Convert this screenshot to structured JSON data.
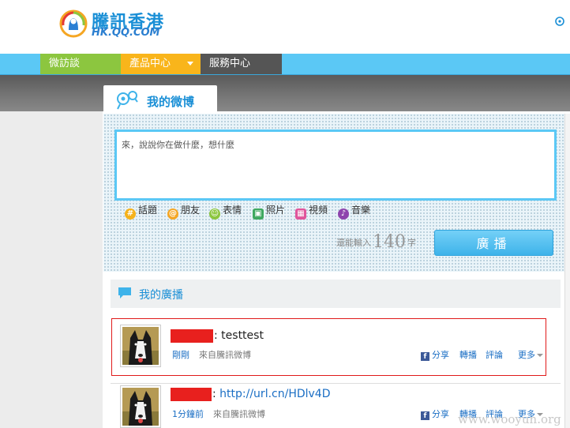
{
  "header": {
    "logo_text": "騰訊香港",
    "logo_sub": "HK.QQ.COM",
    "icon": "weibo-icon"
  },
  "nav": {
    "items": [
      {
        "label": "微訪談",
        "color": "#8cc63f"
      },
      {
        "label": "產品中心",
        "color": "#f9b51b"
      },
      {
        "label": "服務中心",
        "color": "#555555"
      }
    ]
  },
  "tab": {
    "label": "我的微博",
    "icon": "weibo-icon"
  },
  "compose": {
    "placeholder": "來，說說你在做什麼，想什麼",
    "tools": [
      {
        "label": "話題",
        "icon": "hashtag-icon",
        "color": "#f5b21b"
      },
      {
        "label": "朋友",
        "icon": "at-icon",
        "color": "#f5a623"
      },
      {
        "label": "表情",
        "icon": "smiley-icon",
        "color": "#8cc63f"
      },
      {
        "label": "照片",
        "icon": "photo-icon",
        "color": "#3fa860"
      },
      {
        "label": "視頻",
        "icon": "video-icon",
        "color": "#e0559b"
      },
      {
        "label": "音樂",
        "icon": "music-icon",
        "color": "#8e44ad"
      }
    ],
    "counter_prefix": "還能輸入",
    "counter_num": "140",
    "counter_suffix": "字",
    "button": "廣播"
  },
  "feed": {
    "title": "我的廣播",
    "posts": [
      {
        "text": ": testtest",
        "link": "",
        "time": "剛剛",
        "source": "來自騰訊微博",
        "actions": {
          "share": "分享",
          "forward": "轉播",
          "comment": "評論",
          "more": "更多"
        }
      },
      {
        "text": ": ",
        "link": "http://url.cn/HDlv4D",
        "time": "1分鐘前",
        "source": "來自騰訊微博",
        "actions": {
          "share": "分享",
          "forward": "轉播",
          "comment": "評論",
          "more": "更多"
        }
      }
    ]
  },
  "watermark": "www.wooyun.org",
  "colors": {
    "accent": "#1a8fd6",
    "nav_bg": "#5bc8f5",
    "highlight_border": "#e01a1a"
  }
}
